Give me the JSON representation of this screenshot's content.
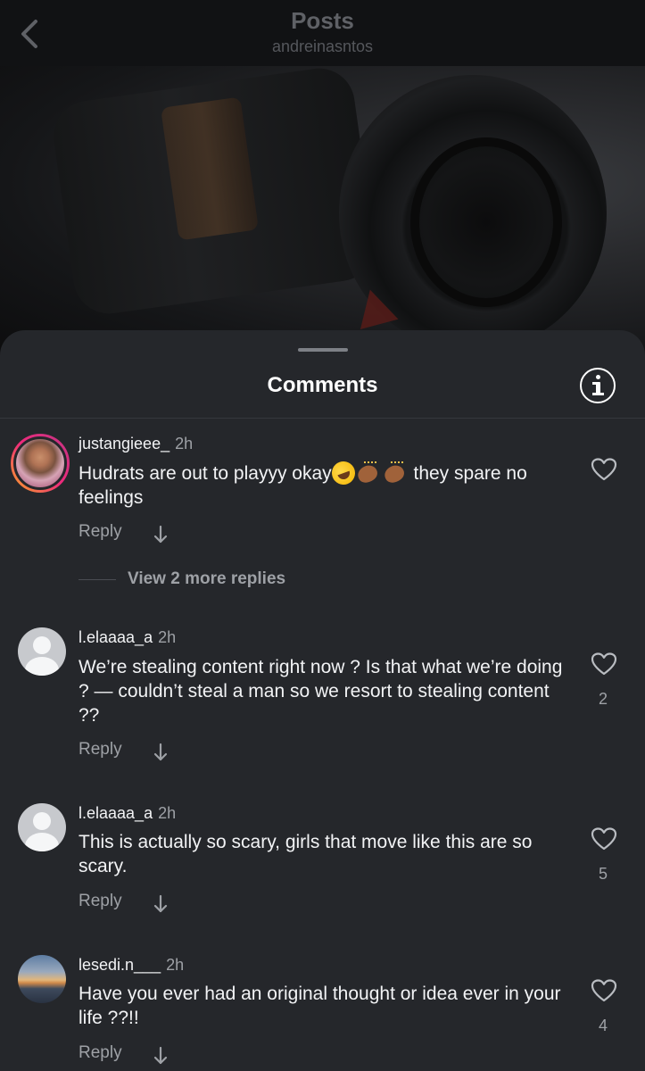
{
  "header": {
    "title": "Posts",
    "subtitle": "andreinasntos"
  },
  "sheet": {
    "title": "Comments"
  },
  "comments": [
    {
      "username": "justangieee_",
      "time": "2h",
      "text_before": "Hudrats are out to playyy okay",
      "text_after": " they spare no feelings",
      "emojis": [
        "rolling-on-floor-laughing",
        "clapping-hands",
        "clapping-hands"
      ],
      "reply_label": "Reply",
      "view_more": "View 2 more replies",
      "likes": ""
    },
    {
      "username": "l.elaaaa_a",
      "time": "2h",
      "text": "We’re stealing content right now ? Is that what we’re doing ? — couldn’t steal a man so we resort to stealing content ??",
      "reply_label": "Reply",
      "likes": "2"
    },
    {
      "username": "l.elaaaa_a",
      "time": "2h",
      "text": "This is actually so scary, girls that move like this are so scary.",
      "reply_label": "Reply",
      "likes": "5"
    },
    {
      "username": "lesedi.n___",
      "time": "2h",
      "text": "Have you ever had an original thought or idea ever in your life ??!!",
      "reply_label": "Reply",
      "likes": "4"
    }
  ]
}
